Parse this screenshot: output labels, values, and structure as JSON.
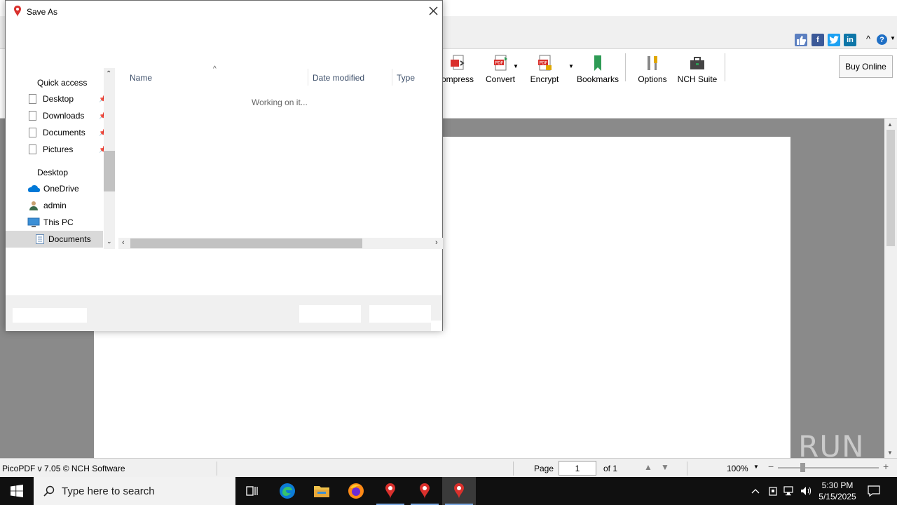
{
  "app": {
    "toolbar": {
      "compress_label": "ompress",
      "convert_label": "Convert",
      "encrypt_label": "Encrypt",
      "bookmarks_label": "Bookmarks",
      "options_label": "Options",
      "nch_suite_label": "NCH Suite",
      "buy_online_label": "Buy Online"
    },
    "social": {
      "collapse_glyph": "^",
      "help_glyph": "?"
    },
    "statusbar": {
      "version_text": "PicoPDF v 7.05 © NCH Software",
      "page_label": "Page",
      "page_value": "1",
      "of_label": "of 1",
      "zoom_value": "100%"
    },
    "watermark_text": "ANY RUN"
  },
  "dialog": {
    "title": "Save As",
    "nav": {
      "quick_access": "Quick access",
      "quick_items": [
        "Desktop",
        "Downloads",
        "Documents",
        "Pictures"
      ],
      "desktop": "Desktop",
      "onedrive": "OneDrive",
      "admin": "admin",
      "this_pc": "This PC",
      "documents": "Documents"
    },
    "columns": {
      "name": "Name",
      "date_modified": "Date modified",
      "type": "Type"
    },
    "status_text": "Working on it..."
  },
  "taskbar": {
    "search_placeholder": "Type here to search",
    "time": "5:30 PM",
    "date": "5/15/2025"
  },
  "colors": {
    "accent_blue": "#0078d7",
    "pdf_red": "#d9302c",
    "bookmark_green": "#2e9b55",
    "taskbar_bg": "#101010",
    "doc_gray": "#8a8a8a"
  }
}
